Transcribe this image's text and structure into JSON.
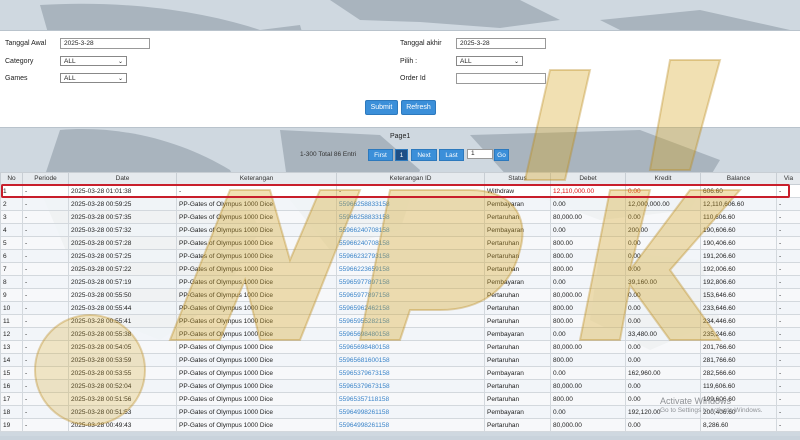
{
  "filters": {
    "tanggal_awal_label": "Tanggal Awal",
    "tanggal_awal_value": "2025-3-28",
    "tanggal_akhir_label": "Tanggal akhir",
    "tanggal_akhir_value": "2025-3-28",
    "category_label": "Category",
    "category_value": "ALL",
    "pilih_label": "Pilih  :",
    "pilih_value": "ALL",
    "games_label": "Games",
    "games_value": "ALL",
    "order_id_label": "Order Id",
    "order_id_value": "",
    "submit_label": "Submit",
    "refresh_label": "Refresh"
  },
  "pager": {
    "page_text": "Page1",
    "total_text": "1-300 Total 86 Entri",
    "first_label": "First",
    "current_page": "1",
    "next_label": "Next",
    "last_label": "Last",
    "page_input": "1",
    "go_label": "Go"
  },
  "table": {
    "headers": [
      "No",
      "Periode",
      "Date",
      "Keterangan",
      "Keterangan ID",
      "Status",
      "Debet",
      "Kredit",
      "Balance",
      "Via"
    ],
    "rows": [
      [
        "1",
        "-",
        "2025-03-28 01:01:38",
        "-",
        "-",
        "Withdraw",
        "12,110,000.00",
        "0.00",
        "606.60",
        "-"
      ],
      [
        "2",
        "-",
        "2025-03-28 00:59:25",
        "PP-Gates of Olympus 1000 Dice",
        "55966258833158",
        "Pembayaran",
        "0.00",
        "12,000,000.00",
        "12,110,606.60",
        "-"
      ],
      [
        "3",
        "-",
        "2025-03-28 00:57:35",
        "PP-Gates of Olympus 1000 Dice",
        "55966258833158",
        "Pertaruhan",
        "80,000.00",
        "0.00",
        "110,606.60",
        "-"
      ],
      [
        "4",
        "-",
        "2025-03-28 00:57:32",
        "PP-Gates of Olympus 1000 Dice",
        "55966240708158",
        "Pembayaran",
        "0.00",
        "200.00",
        "190,606.60",
        "-"
      ],
      [
        "5",
        "-",
        "2025-03-28 00:57:28",
        "PP-Gates of Olympus 1000 Dice",
        "55966240708158",
        "Pertaruhan",
        "800.00",
        "0.00",
        "190,406.60",
        "-"
      ],
      [
        "6",
        "-",
        "2025-03-28 00:57:25",
        "PP-Gates of Olympus 1000 Dice",
        "55966232793158",
        "Pertaruhan",
        "800.00",
        "0.00",
        "191,206.60",
        "-"
      ],
      [
        "7",
        "-",
        "2025-03-28 00:57:22",
        "PP-Gates of Olympus 1000 Dice",
        "55966223659158",
        "Pertaruhan",
        "800.00",
        "0.00",
        "192,006.60",
        "-"
      ],
      [
        "8",
        "-",
        "2025-03-28 00:57:19",
        "PP-Gates of Olympus 1000 Dice",
        "55965977897158",
        "Pembayaran",
        "0.00",
        "39,160.00",
        "192,806.60",
        "-"
      ],
      [
        "9",
        "-",
        "2025-03-28 00:55:50",
        "PP-Gates of Olympus 1000 Dice",
        "55965977897158",
        "Pertaruhan",
        "80,000.00",
        "0.00",
        "153,646.60",
        "-"
      ],
      [
        "10",
        "-",
        "2025-03-28 00:55:44",
        "PP-Gates of Olympus 1000 Dice",
        "55965962462158",
        "Pertaruhan",
        "800.00",
        "0.00",
        "233,646.60",
        "-"
      ],
      [
        "11",
        "-",
        "2025-03-28 00:55:41",
        "PP-Gates of Olympus 1000 Dice",
        "55965955282158",
        "Pertaruhan",
        "800.00",
        "0.00",
        "234,446.60",
        "-"
      ],
      [
        "12",
        "-",
        "2025-03-28 00:55:38",
        "PP-Gates of Olympus 1000 Dice",
        "55965698480158",
        "Pembayaran",
        "0.00",
        "33,480.00",
        "235,246.60",
        "-"
      ],
      [
        "13",
        "-",
        "2025-03-28 00:54:05",
        "PP-Gates of Olympus 1000 Dice",
        "55965698480158",
        "Pertaruhan",
        "80,000.00",
        "0.00",
        "201,766.60",
        "-"
      ],
      [
        "14",
        "-",
        "2025-03-28 00:53:59",
        "PP-Gates of Olympus 1000 Dice",
        "55965681600158",
        "Pertaruhan",
        "800.00",
        "0.00",
        "281,766.60",
        "-"
      ],
      [
        "15",
        "-",
        "2025-03-28 00:53:55",
        "PP-Gates of Olympus 1000 Dice",
        "55965379673158",
        "Pembayaran",
        "0.00",
        "162,960.00",
        "282,566.60",
        "-"
      ],
      [
        "16",
        "-",
        "2025-03-28 00:52:04",
        "PP-Gates of Olympus 1000 Dice",
        "55965379673158",
        "Pertaruhan",
        "80,000.00",
        "0.00",
        "119,606.60",
        "-"
      ],
      [
        "17",
        "-",
        "2025-03-28 00:51:56",
        "PP-Gates of Olympus 1000 Dice",
        "55965357118158",
        "Pertaruhan",
        "800.00",
        "0.00",
        "199,606.60",
        "-"
      ],
      [
        "18",
        "-",
        "2025-03-28 00:51:53",
        "PP-Gates of Olympus 1000 Dice",
        "55964998261158",
        "Pembayaran",
        "0.00",
        "192,120.00",
        "200,406.60",
        "-"
      ],
      [
        "19",
        "-",
        "2025-03-28 00:49:43",
        "PP-Gates of Olympus 1000 Dice",
        "55964998261158",
        "Pertaruhan",
        "80,000.00",
        "0.00",
        "8,286.60",
        "-"
      ]
    ]
  },
  "overlay": {
    "activate_title": "Activate Windows",
    "activate_sub": "Go to Settings to activate Windows."
  },
  "colors": {
    "accent": "#3b8fd9",
    "highlight_border": "#c81e2b",
    "link": "#3a84c9",
    "watermark": "#d8a623"
  }
}
